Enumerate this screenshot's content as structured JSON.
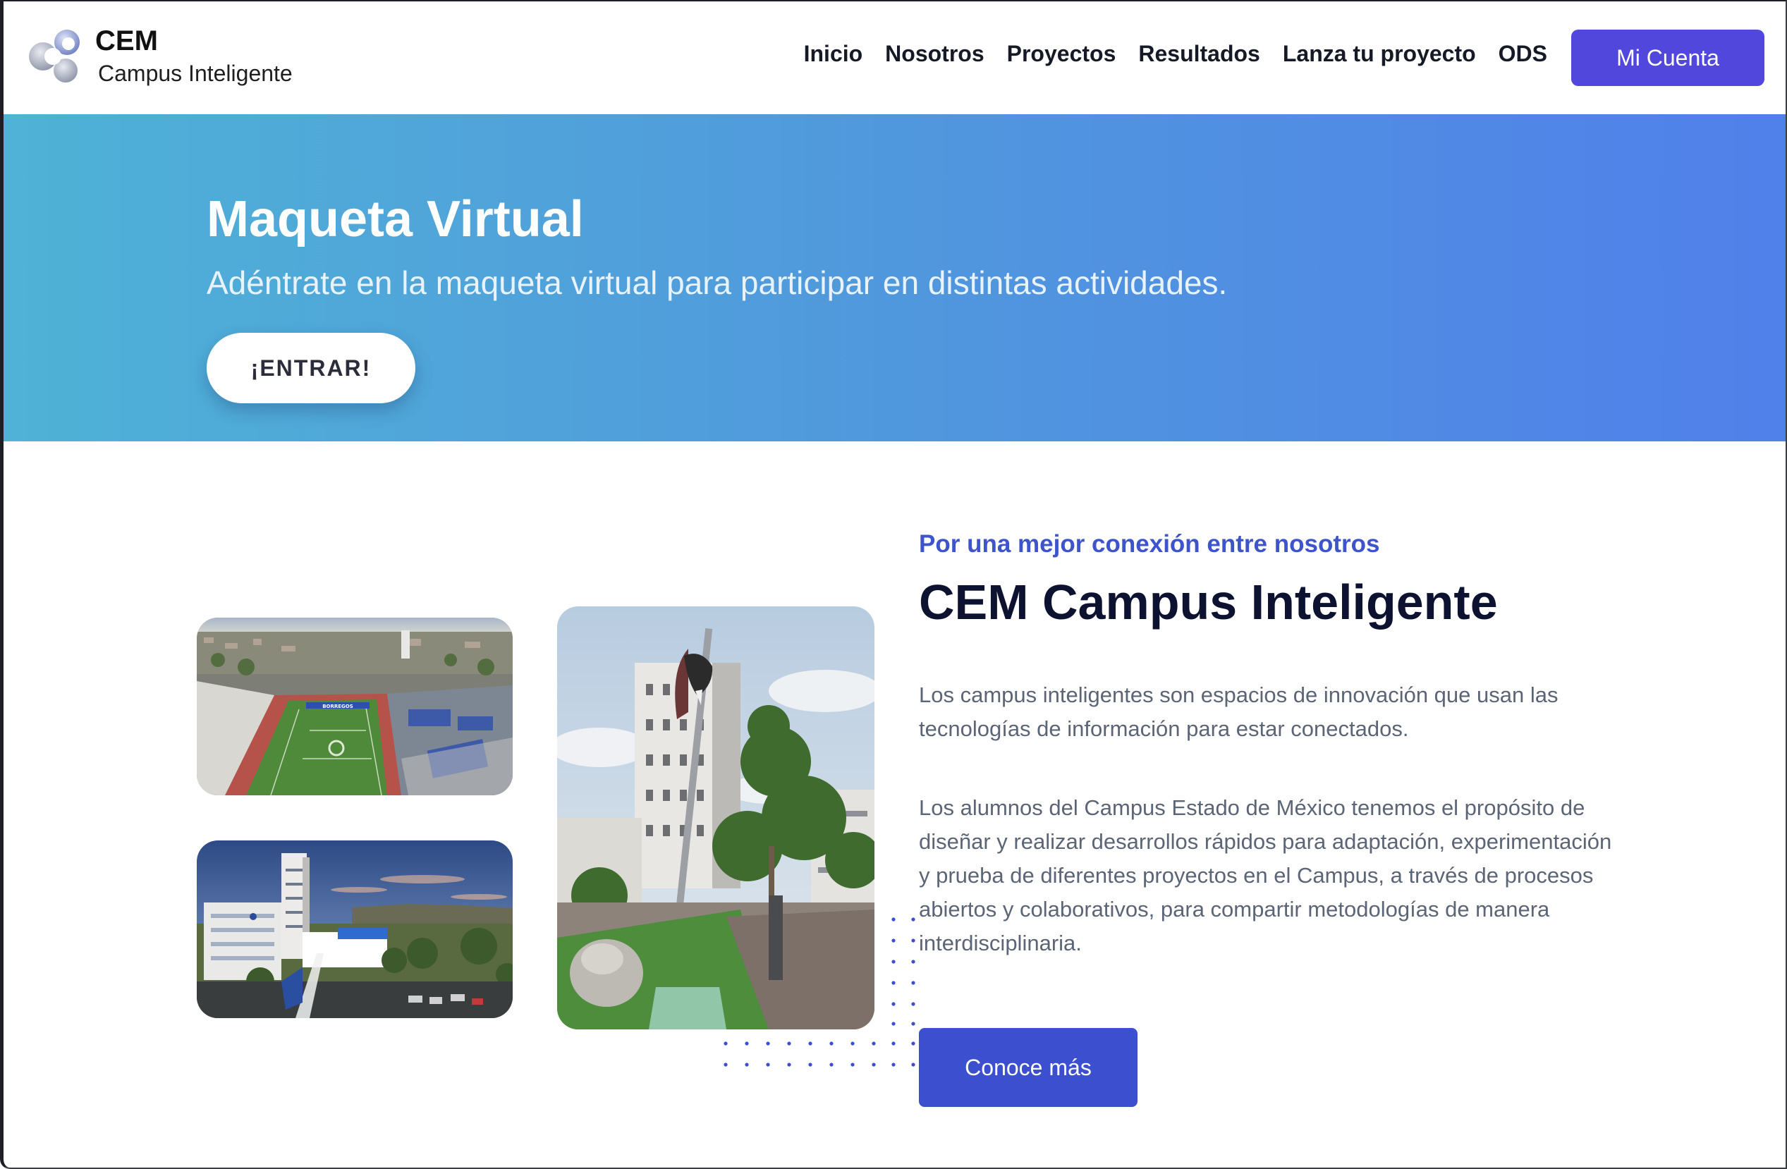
{
  "brand": {
    "name": "CEM",
    "subtitle": "Campus Inteligente"
  },
  "nav": {
    "links": [
      "Inicio",
      "Nosotros",
      "Proyectos",
      "Resultados",
      "Lanza tu proyecto",
      "ODS"
    ],
    "account_label": "Mi Cuenta"
  },
  "hero": {
    "title": "Maqueta Virtual",
    "subtitle": "Adéntrate en la maqueta virtual para participar en distintas actividades.",
    "cta_label": "¡ENTRAR!"
  },
  "about": {
    "eyebrow": "Por una mejor conexión entre nosotros",
    "title": "CEM Campus Inteligente",
    "paragraph_1": "Los campus inteligentes son espacios de innovación que usan las tecnologías de información para estar conectados.",
    "paragraph_2": "Los alumnos del Campus Estado de México tenemos el propósito de diseñar y realizar desarrollos rápidos para adaptación, experimentación y prueba de diferentes proyectos en el Campus, a través de procesos abiertos y colaborativos, para compartir metodologías de manera interdisciplinaria.",
    "cta_label": "Conoce más",
    "stadium_banner": "BORREGOS"
  },
  "colors": {
    "accent": "#5147dd",
    "button_blue": "#3b4fcf",
    "eyebrow_blue": "#3d54cc",
    "hero_gradient_start": "#4fb2d6",
    "hero_gradient_end": "#5080ea",
    "heading_dark": "#0d1230",
    "body_text": "#5b6576"
  },
  "icons": {
    "logo": "cem-logo-icon"
  }
}
